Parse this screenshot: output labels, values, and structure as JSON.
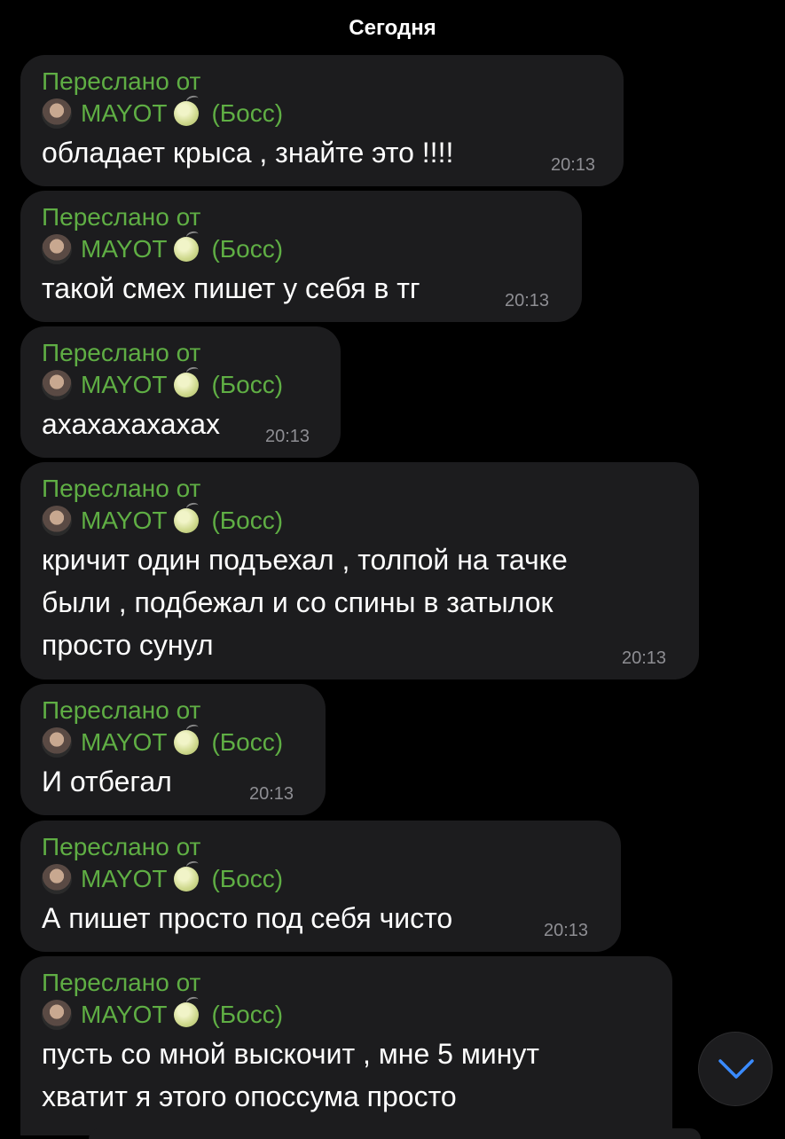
{
  "date_header": "Сегодня",
  "messages": [
    {
      "forwarded_label": "Переслано от",
      "sender": "MAYOT",
      "sender_title": "(Босс)",
      "text": "обладает крыса , знайте это !!!!",
      "time": "20:13"
    },
    {
      "forwarded_label": "Переслано от",
      "sender": "MAYOT",
      "sender_title": "(Босс)",
      "text": "такой смех пишет у себя в тг",
      "time": "20:13"
    },
    {
      "forwarded_label": "Переслано от",
      "sender": "MAYOT",
      "sender_title": "(Босс)",
      "text": "ахахахахахах",
      "time": "20:13"
    },
    {
      "forwarded_label": "Переслано от",
      "sender": "MAYOT",
      "sender_title": "(Босс)",
      "text": "кричит один подъехал , толпой на тачке\nбыли , подбежал и со спины в затылок\nпросто сунул",
      "time": "20:13"
    },
    {
      "forwarded_label": "Переслано от",
      "sender": "MAYOT",
      "sender_title": "(Босс)",
      "text": "И отбегал",
      "time": "20:13"
    },
    {
      "forwarded_label": "Переслано от",
      "sender": "MAYOT",
      "sender_title": "(Босс)",
      "text": "А пишет просто под себя чисто",
      "time": "20:13"
    },
    {
      "forwarded_label": "Переслано от",
      "sender": "MAYOT",
      "sender_title": "(Босс)",
      "text": "пусть со мной выскочит , мне 5 минут\nхватит я этого опоссума просто",
      "time": ""
    }
  ],
  "icons": {
    "avatar": "avatar",
    "sender_emoji": "melon-icon",
    "scroll_down": "chevron-down-icon"
  },
  "colors": {
    "background": "#000000",
    "bubble": "#1c1c1e",
    "accent_green": "#5fae44",
    "text": "#ffffff",
    "time": "#8e8e93",
    "chevron_blue": "#3a8bff"
  }
}
